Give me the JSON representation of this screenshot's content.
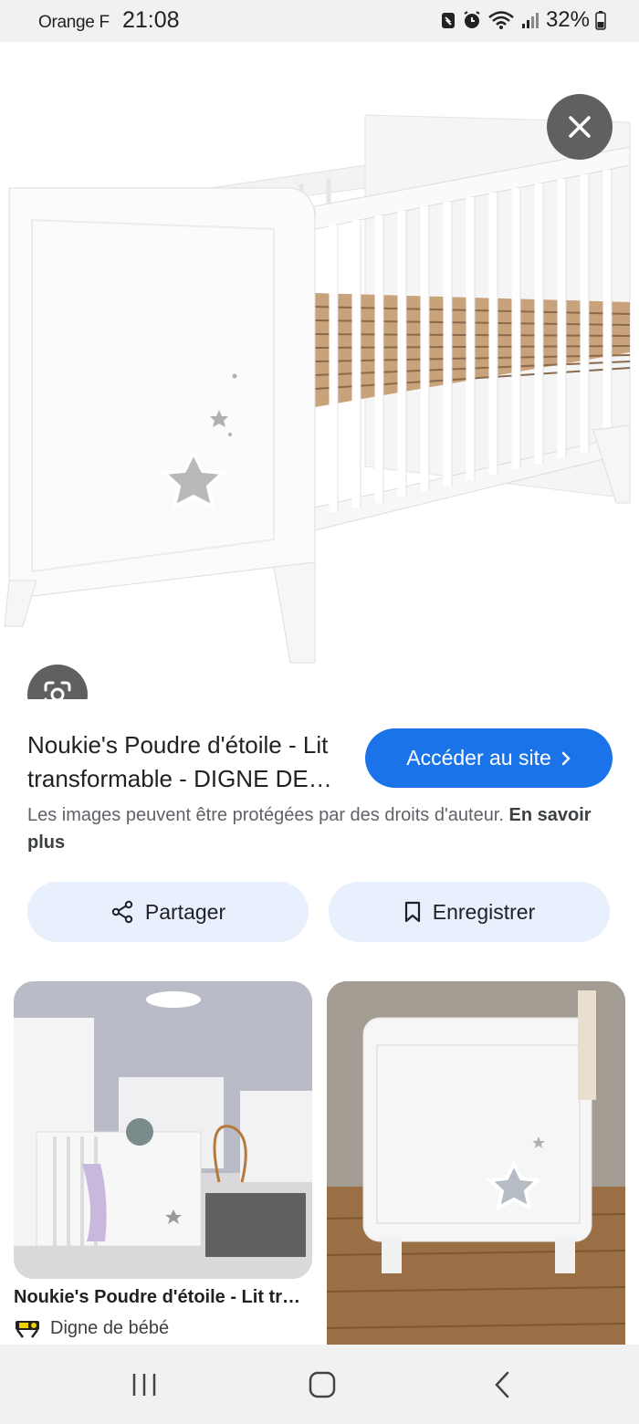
{
  "status_bar": {
    "carrier": "Orange F",
    "time": "21:08",
    "battery": "32%"
  },
  "hero": {
    "close_icon": "close-icon",
    "lens_icon": "google-lens-icon"
  },
  "result": {
    "title": "Noukie's Poudre d'étoile - Lit transformable - DIGNE DE BÉBÉ",
    "visit_label": "Accéder au site",
    "copyright_text": "Les images peuvent être protégées par des droits d'auteur.",
    "learn_more": "En savoir plus",
    "share_label": "Partager",
    "save_label": "Enregistrer"
  },
  "related": [
    {
      "title": "Noukie's Poudre d'étoile - Lit transformable",
      "source": "Digne de bébé"
    }
  ],
  "colors": {
    "accent": "#1a73e8",
    "chip_bg": "#e8effd",
    "overlay_btn": "#5f6061"
  }
}
